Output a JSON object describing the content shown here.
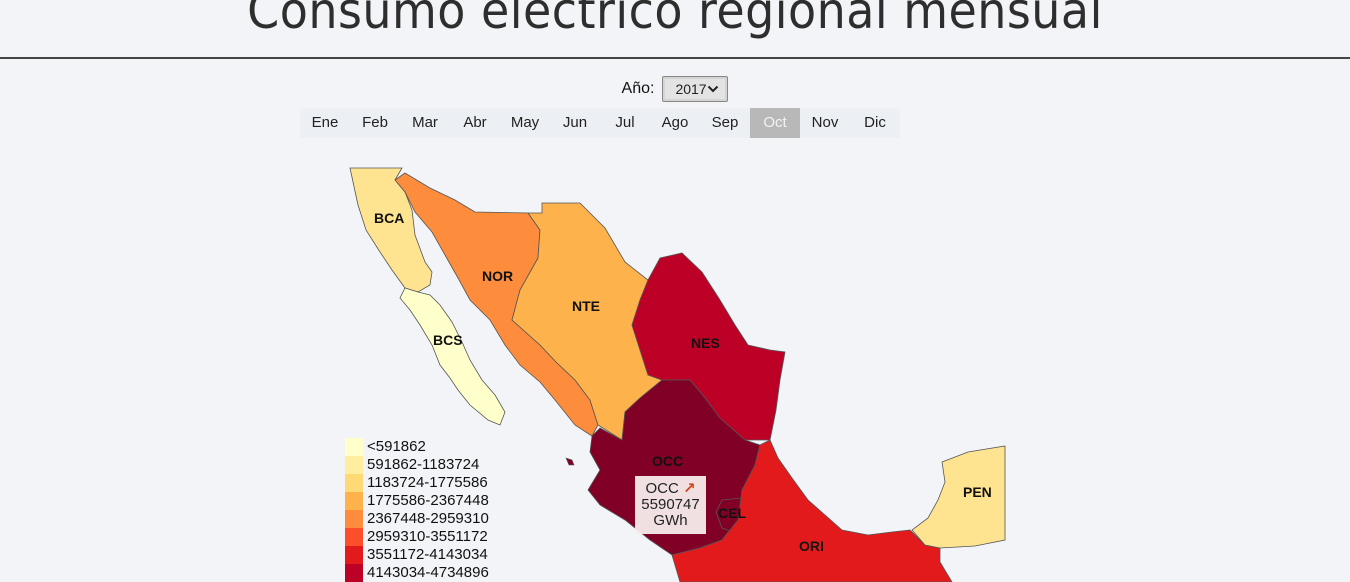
{
  "title": "Consumo eléctrico regional mensual",
  "year_selector": {
    "label": "Año:",
    "value": "2017"
  },
  "months": [
    {
      "label": "Ene",
      "active": false
    },
    {
      "label": "Feb",
      "active": false
    },
    {
      "label": "Mar",
      "active": false
    },
    {
      "label": "Abr",
      "active": false
    },
    {
      "label": "May",
      "active": false
    },
    {
      "label": "Jun",
      "active": false
    },
    {
      "label": "Jul",
      "active": false
    },
    {
      "label": "Ago",
      "active": false
    },
    {
      "label": "Sep",
      "active": false
    },
    {
      "label": "Oct",
      "active": true
    },
    {
      "label": "Nov",
      "active": false
    },
    {
      "label": "Dic",
      "active": false
    }
  ],
  "regions": [
    {
      "code": "BCA",
      "color": "#fee391"
    },
    {
      "code": "BCS",
      "color": "#ffffcc"
    },
    {
      "code": "NOR",
      "color": "#fd8d3c"
    },
    {
      "code": "NTE",
      "color": "#feb24c"
    },
    {
      "code": "NES",
      "color": "#bd0026"
    },
    {
      "code": "OCC",
      "color": "#800026"
    },
    {
      "code": "CEL",
      "color": "#800026"
    },
    {
      "code": "ORI",
      "color": "#e31a1c"
    },
    {
      "code": "PEN",
      "color": "#fee391"
    }
  ],
  "legend": [
    {
      "label": "<591862",
      "color": "#ffffcc"
    },
    {
      "label": "591862-1183724",
      "color": "#ffeda0"
    },
    {
      "label": "1183724-1775586",
      "color": "#fed976"
    },
    {
      "label": "1775586-2367448",
      "color": "#feb24c"
    },
    {
      "label": "2367448-2959310",
      "color": "#fd8d3c"
    },
    {
      "label": "2959310-3551172",
      "color": "#fc4e2a"
    },
    {
      "label": "3551172-4143034",
      "color": "#e31a1c"
    },
    {
      "label": "4143034-4734896",
      "color": "#bd0026"
    }
  ],
  "tooltip": {
    "region": "OCC",
    "trend_icon": "↗",
    "value": "5590747",
    "unit": "GWh"
  }
}
